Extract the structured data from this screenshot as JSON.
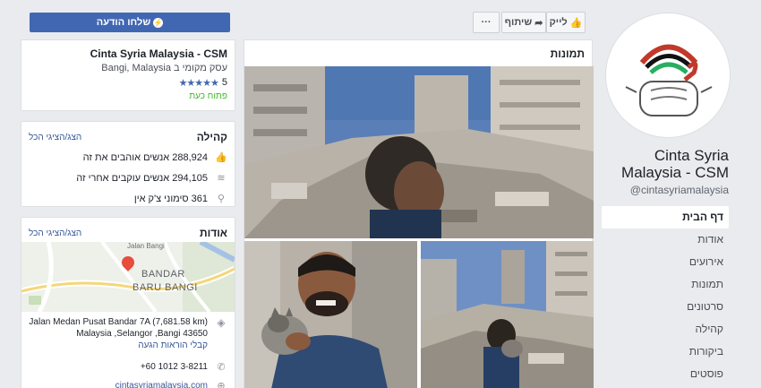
{
  "page": {
    "name": "Cinta Syria Malaysia - CSM",
    "handle": "@cintasyriamalaysia"
  },
  "sidebar": {
    "items": [
      {
        "label": "דף הבית",
        "active": true
      },
      {
        "label": "אודות"
      },
      {
        "label": "אירועים"
      },
      {
        "label": "תמונות"
      },
      {
        "label": "סרטונים"
      },
      {
        "label": "קהילה"
      },
      {
        "label": "ביקורות"
      },
      {
        "label": "פוסטים"
      }
    ]
  },
  "actions": {
    "like": "לייק",
    "share": "שיתוף",
    "more": "···",
    "message": "שלחו הודעה"
  },
  "photos": {
    "title": "תמונות"
  },
  "info_card": {
    "title": "Cinta Syria Malaysia - CSM",
    "category": "עסק מקומי ב Bangi, Malaysia",
    "rating": "5",
    "stars": "★★★★★",
    "status": "פתוח כעת"
  },
  "community": {
    "title": "קהילה",
    "see_all": "הצג/הציגי הכל",
    "likes": "288,924 אנשים אוהבים את זה",
    "follows": "294,105 אנשים עוקבים אחרי זה",
    "checkins": "361 סימוני צ'ק אין"
  },
  "about": {
    "title": "אודות",
    "see_all": "הצג/הציגי הכל",
    "map_label_1": "BANDAR",
    "map_label_2": "BARU BANGI",
    "map_street": "Jalan Bangi",
    "address_1": "Jalan Medan Pusat Bandar 7A (7,681.58 km)",
    "address_2": "Malaysia ,Selangor ,Bangi 43650",
    "directions": "קבלי הוראות הגעה",
    "phone": "+60 1012 3-8211",
    "website": "cintasyriamalaysia.com"
  },
  "colors": {
    "brand_blue": "#4267b2",
    "link_blue": "#385898",
    "open_green": "#42b72a",
    "star_blue": "#4267b2"
  }
}
